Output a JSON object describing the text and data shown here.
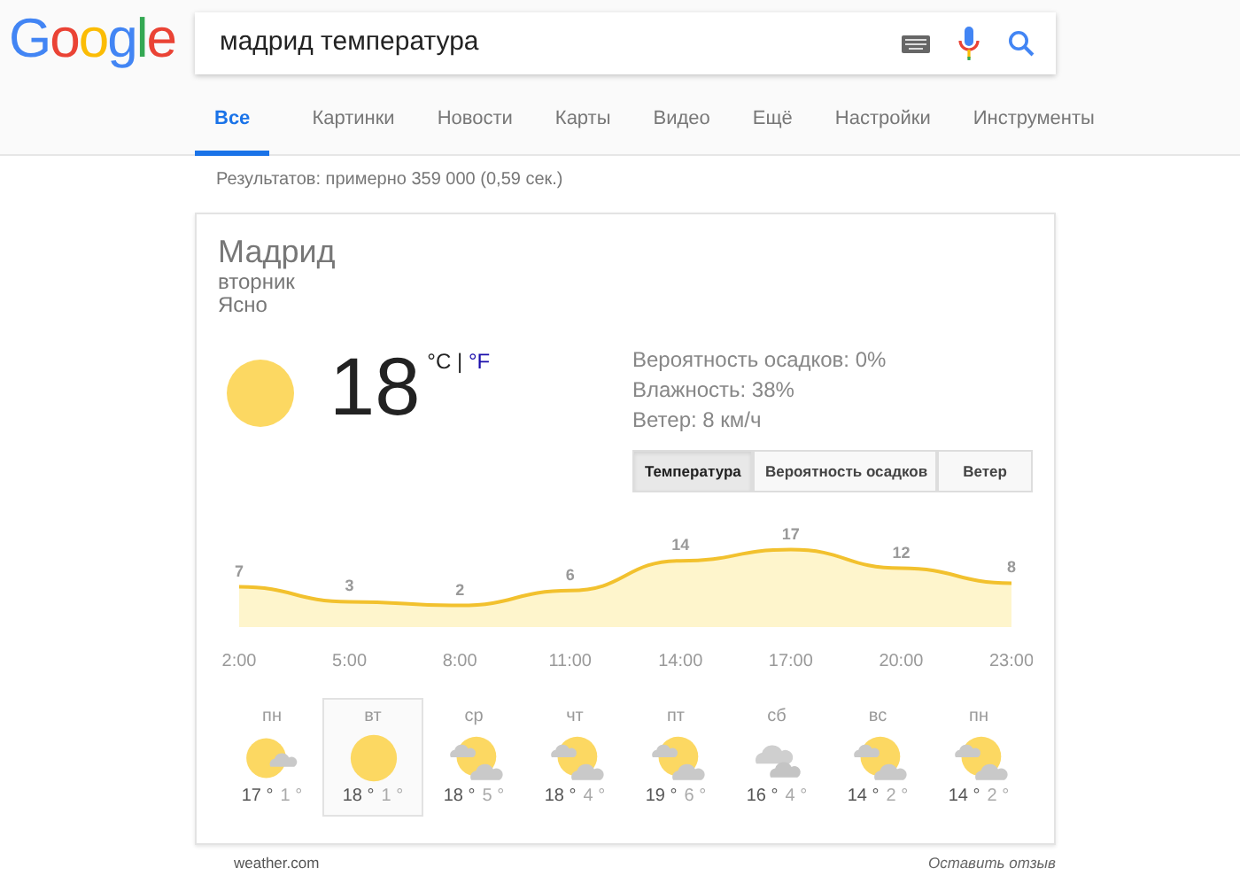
{
  "logo": "Google",
  "search": {
    "value": "мадрид температура"
  },
  "tabs": [
    {
      "label": "Все",
      "selected": true
    },
    {
      "label": "Картинки",
      "selected": false
    },
    {
      "label": "Новости",
      "selected": false
    },
    {
      "label": "Карты",
      "selected": false
    },
    {
      "label": "Видео",
      "selected": false
    },
    {
      "label": "Ещё",
      "selected": false
    },
    {
      "label": "Настройки",
      "selected": false
    },
    {
      "label": "Инструменты",
      "selected": false
    }
  ],
  "result_stats": "Результатов: примерно 359 000 (0,59 сек.)",
  "weather": {
    "city": "Мадрид",
    "day": "вторник",
    "condition": "Ясно",
    "temperature": "18",
    "unit_c": "°C",
    "unit_sep": "|",
    "unit_f": "°F",
    "details": [
      "Вероятность осадков: 0%",
      "Влажность: 38%",
      "Ветер: 8 км/ч"
    ],
    "chart_tabs": [
      {
        "label": "Температура",
        "selected": true
      },
      {
        "label": "Вероятность осадков",
        "selected": false
      },
      {
        "label": "Ветер",
        "selected": false
      }
    ],
    "chart_data": {
      "type": "area",
      "categories": [
        "2:00",
        "5:00",
        "8:00",
        "11:00",
        "14:00",
        "17:00",
        "20:00",
        "23:00"
      ],
      "series": [
        {
          "color": "#f2c12e",
          "values": [
            7,
            3,
            2,
            6,
            14,
            17,
            12,
            8
          ]
        }
      ],
      "data_labels": true
    },
    "forecast": [
      {
        "day": "пн",
        "kind": "sun-small-cloud",
        "high": "17 °",
        "low": "1 °",
        "selected": false
      },
      {
        "day": "вт",
        "kind": "sun",
        "high": "18 °",
        "low": "1 °",
        "selected": true
      },
      {
        "day": "ср",
        "kind": "partly-cloudy",
        "high": "18 °",
        "low": "5 °",
        "selected": false
      },
      {
        "day": "чт",
        "kind": "partly-cloudy",
        "high": "18 °",
        "low": "4 °",
        "selected": false
      },
      {
        "day": "пт",
        "kind": "partly-cloudy",
        "high": "19 °",
        "low": "6 °",
        "selected": false
      },
      {
        "day": "сб",
        "kind": "cloudy",
        "high": "16 °",
        "low": "4 °",
        "selected": false
      },
      {
        "day": "вс",
        "kind": "partly-cloudy",
        "high": "14 °",
        "low": "2 °",
        "selected": false
      },
      {
        "day": "пн",
        "kind": "partly-cloudy",
        "high": "14 °",
        "low": "2 °",
        "selected": false
      }
    ]
  },
  "footer": {
    "source": "weather.com",
    "feedback": "Оставить отзыв"
  }
}
